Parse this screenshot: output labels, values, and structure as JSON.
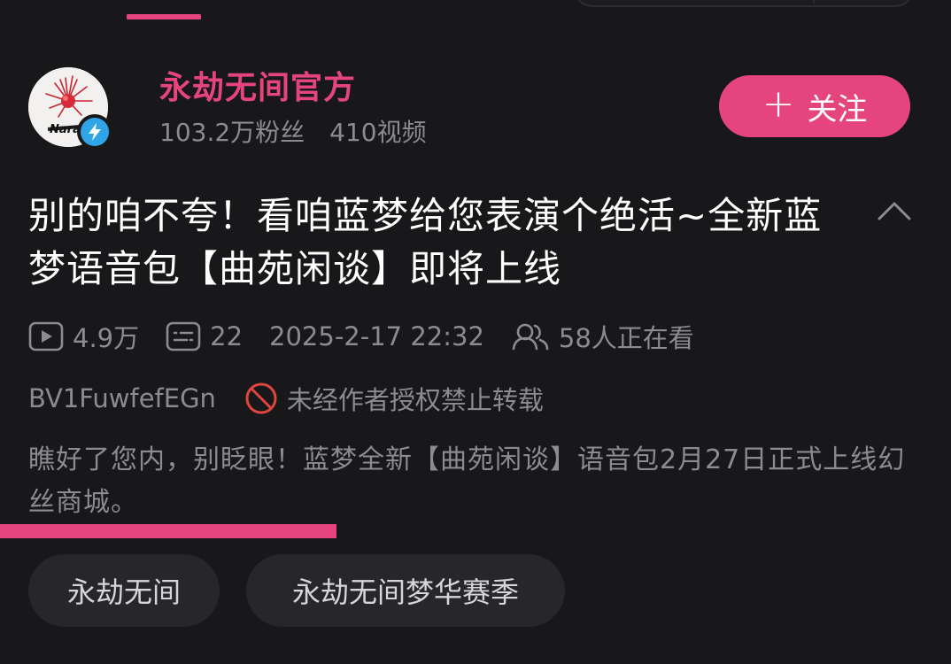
{
  "author": {
    "name": "永劫无间官方",
    "fans": "103.2万粉丝",
    "videos": "410视频",
    "avatar_icon": "spider-lily-logo-icon",
    "verified_icon": "lightning-badge-icon"
  },
  "follow": {
    "plus": "+",
    "label": "关注"
  },
  "video": {
    "title": "别的咱不夸！看咱蓝梦给您表演个绝活~全新蓝梦语音包【曲苑闲谈】即将上线",
    "views": "4.9万",
    "comments": "22",
    "date": "2025-2-17 22:32",
    "watching": "58人正在看",
    "bvid": "BV1FuwfefEGn",
    "repost_notice": "未经作者授权禁止转载",
    "description": "瞧好了您内，别眨眼！蓝梦全新【曲苑闲谈】语音包2月27日正式上线幻丝商城。"
  },
  "tags": [
    "永劫无间",
    "永劫无间梦华赛季"
  ],
  "colors": {
    "accent": "#e5457c",
    "background": "#18181a",
    "muted_text": "#8b8b90",
    "tag_bg": "#27272a",
    "verified_blue": "#2fa4e7"
  }
}
